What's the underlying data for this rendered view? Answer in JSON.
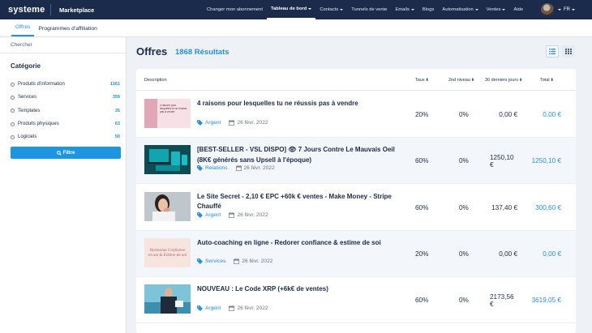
{
  "app": {
    "brand": "systeme",
    "section": "Marketplace"
  },
  "nav": [
    {
      "label": "Changer mon abonnement",
      "dropdown": false,
      "active": false
    },
    {
      "label": "Tableau de bord",
      "dropdown": true,
      "active": true
    },
    {
      "label": "Contacts",
      "dropdown": true,
      "active": false
    },
    {
      "label": "Tunnels de vente",
      "dropdown": false,
      "active": false
    },
    {
      "label": "Emails",
      "dropdown": true,
      "active": false
    },
    {
      "label": "Blogs",
      "dropdown": false,
      "active": false
    },
    {
      "label": "Automatisation",
      "dropdown": true,
      "active": false
    },
    {
      "label": "Ventes",
      "dropdown": true,
      "active": false
    },
    {
      "label": "Aide",
      "dropdown": false,
      "active": false
    }
  ],
  "lang": "FR",
  "subtabs": [
    "Offres",
    "Programmes d'affiliation"
  ],
  "sidebar": {
    "search_placeholder": "Chercher",
    "category_title": "Catégorie",
    "categories": [
      {
        "label": "Produits d'information",
        "count": "1361"
      },
      {
        "label": "Services",
        "count": "359"
      },
      {
        "label": "Templates",
        "count": "35"
      },
      {
        "label": "Produits physiques",
        "count": "63"
      },
      {
        "label": "Logiciels",
        "count": "50"
      }
    ],
    "filter_label": "Filtre"
  },
  "main": {
    "title": "Offres",
    "results": "1868 Résultats",
    "columns": {
      "description": "Description",
      "rate": "Taux",
      "second": "2nd niveau",
      "last30": "30 derniers jours",
      "total": "Total"
    },
    "rows": [
      {
        "title": "4 raisons pour lesquelles tu ne réussis pas à vendre",
        "tag": "Argent",
        "date": "26 févr. 2022",
        "rate": "20%",
        "second": "0%",
        "last30": "0,00 €",
        "total": "0,00 €",
        "thumb": "pink-text",
        "thumb_text": "4 raisons pour lesquelles tu ne réussis pas à vendre"
      },
      {
        "title": "[BEST-SELLER - VSL DISPO] 👁 7 Jours Contre Le Mauvais Oeil (8K€ générés sans Upsell à l'époque)",
        "tag": "Relations",
        "date": "26 févr. 2022",
        "rate": "60%",
        "second": "0%",
        "last30": "1250,10 €",
        "total": "1250,10 €",
        "thumb": "teal-devices",
        "thumb_text": ""
      },
      {
        "title": "Le Site Secret - 2,10 € EPC +60k € ventes - Make Money - Stripe Chauffé",
        "tag": "Argent",
        "date": "26 févr. 2022",
        "rate": "60%",
        "second": "0%",
        "last30": "137,40 €",
        "total": "300,60 €",
        "thumb": "photo-woman",
        "thumb_text": ""
      },
      {
        "title": "Auto-coaching en ligne - Redorer confiance & estime de soi",
        "tag": "Services",
        "date": "26 févr. 2022",
        "rate": "20%",
        "second": "0%",
        "last30": "0,00 €",
        "total": "0,00 €",
        "thumb": "pink-script",
        "thumb_text": "Harmonie Confiance en soi & Estime de soi"
      },
      {
        "title": "NOUVEAU : Le Code XRP (+6k€ de ventes)",
        "tag": "Argent",
        "date": "26 févr. 2022",
        "rate": "60%",
        "second": "0%",
        "last30": "2173,56 €",
        "total": "3619,05 €",
        "thumb": "photo-man",
        "thumb_text": ""
      }
    ]
  },
  "colors": {
    "nav_bg": "#1a2b4c",
    "accent": "#2a8fd8",
    "button": "#1e95e0"
  }
}
